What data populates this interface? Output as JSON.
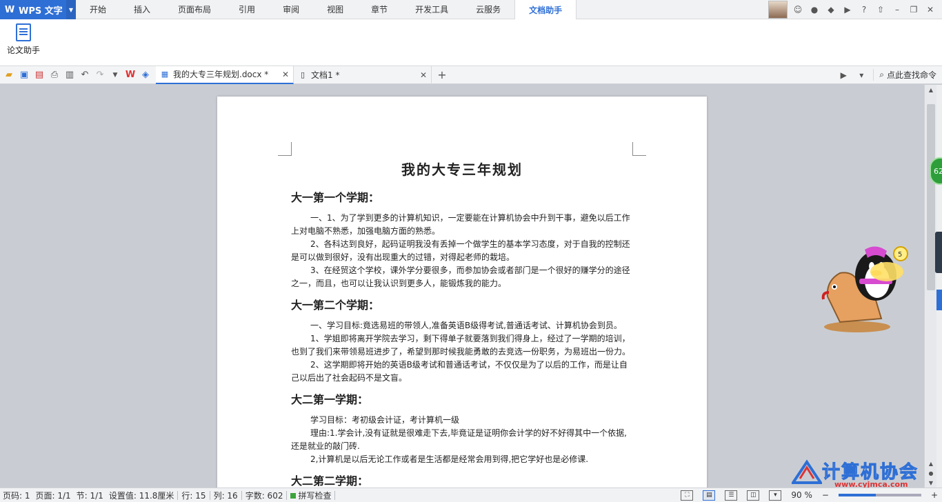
{
  "menubar": {
    "app_label": "WPS 文字",
    "tabs": [
      "开始",
      "插入",
      "页面布局",
      "引用",
      "审阅",
      "视图",
      "章节",
      "开发工具",
      "云服务",
      "文档助手"
    ],
    "active_tab": "文档助手"
  },
  "ribbon": {
    "paper_assistant_label": "论文助手"
  },
  "tabbar": {
    "docs": [
      {
        "title": "我的大专三年规划.docx *"
      },
      {
        "title": "文档1 *"
      }
    ],
    "search_label": "点此查找命令"
  },
  "document": {
    "title": "我的大专三年规划",
    "sections": [
      {
        "heading": "大一第一个学期：",
        "paragraphs": [
          "一、1、为了学到更多的计算机知识，一定要能在计算机协会中升到干事，避免以后工作上对电脑不熟悉，加强电脑方面的熟悉。",
          " 2、各科达到良好，起码证明我没有丢掉一个做学生的基本学习态度，对于自我的控制还是可以做到很好，没有出现重大的过错，对得起老师的栽培。",
          "3、在经贸这个学校，课外学分要很多，而参加协会或者部门是一个很好的赚学分的途径之一，而且，也可以让我认识到更多人，能锻炼我的能力。"
        ]
      },
      {
        "heading": "大一第二个学期：",
        "paragraphs": [
          "一、学习目标:竟选易班的带领人,准备英语B级得考试,普通话考试、计算机协会到员。",
          "1、学姐即将离开学院去学习，剩下得单子就要落到我们得身上，经过了一学期的培训，也到了我们来带领易班进步了，希望到那时候我能勇敢的去竞选一份职务，为易班出一份力。",
          "2、这学期即将开始的英语B级考试和普通话考试，不仅仅是为了以后的工作，而是让自己以后出了社会起码不是文盲。"
        ]
      },
      {
        "heading": "大二第一学期：",
        "paragraphs": [
          "学习目标：考初级会计证，考计算机一级",
          " 理由:1.学会计,没有证就是很难走下去,毕竟证是证明你会计学的好不好得其中一个依据,还是就业的敲门砖.",
          "2,计算机是以后无论工作或者是生活都是经常会用到得,把它学好也是必修课."
        ]
      },
      {
        "heading": "大二第二学期：",
        "paragraphs": []
      }
    ]
  },
  "side": {
    "green_badge": "62"
  },
  "watermark": {
    "text": "计算机协会",
    "url": "www.cyjmca.com"
  },
  "statusbar": {
    "items": [
      "页码: 1",
      "页面: 1/1",
      "节: 1/1",
      "设置值: 11.8厘米",
      "行: 15",
      "列: 16",
      "字数: 602"
    ],
    "spell_check": "拼写检查",
    "zoom": "90 %",
    "zoom_fraction": 0.45
  },
  "colors": {
    "accent": "#2e6fd6",
    "spell_ok": "#3ca43c"
  }
}
